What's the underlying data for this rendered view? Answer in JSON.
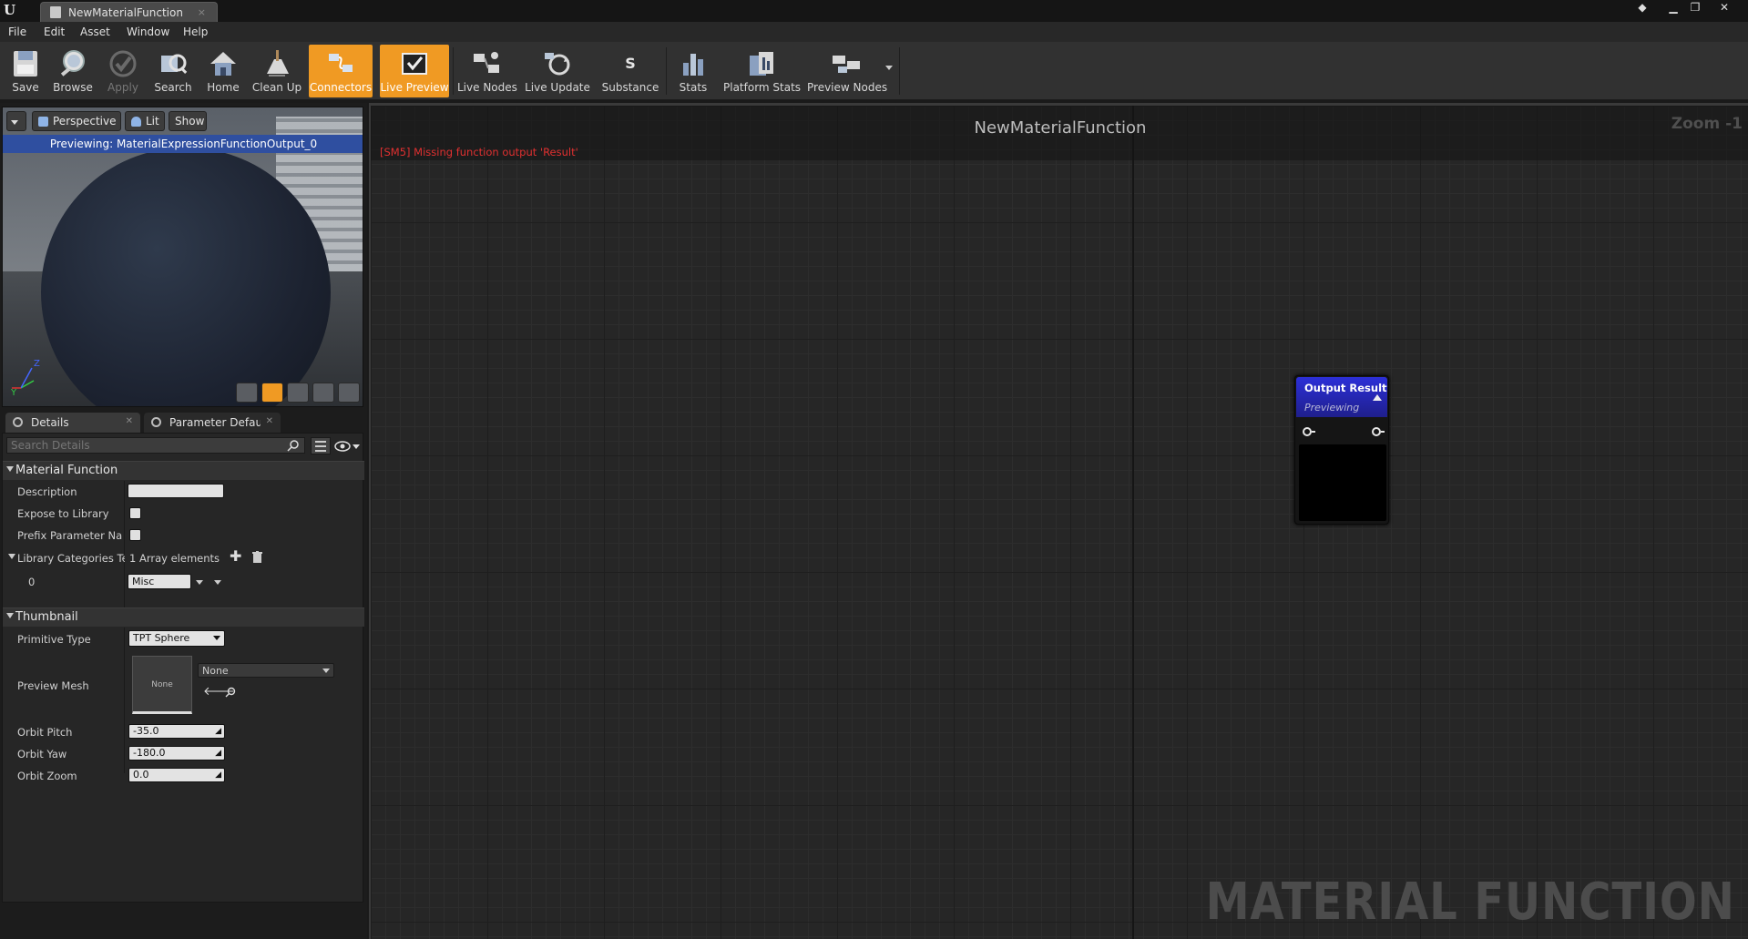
{
  "window": {
    "tab_title": "NewMaterialFunction",
    "tab_close": "×"
  },
  "menu": {
    "items": [
      "File",
      "Edit",
      "Asset",
      "Window",
      "Help"
    ]
  },
  "toolbar": {
    "buttons": [
      {
        "label": "Save",
        "icon": "save-icon"
      },
      {
        "label": "Browse",
        "icon": "browse-icon"
      },
      {
        "label": "Apply",
        "icon": "apply-icon",
        "state": "disabled"
      },
      {
        "label": "Search",
        "icon": "search-icon"
      },
      {
        "label": "Home",
        "icon": "home-icon"
      },
      {
        "label": "Clean Up",
        "icon": "clean-up-icon"
      },
      {
        "label": "Connectors",
        "icon": "connectors-icon",
        "state": "active"
      },
      {
        "label": "Live Preview",
        "icon": "live-preview-icon",
        "state": "active"
      },
      {
        "label": "Live Nodes",
        "icon": "live-nodes-icon"
      },
      {
        "label": "Live Update",
        "icon": "live-update-icon"
      },
      {
        "label": "Substance",
        "icon": "substance-icon"
      },
      {
        "label": "Stats",
        "icon": "stats-icon"
      },
      {
        "label": "Platform Stats",
        "icon": "platform-stats-icon"
      },
      {
        "label": "Preview Nodes",
        "icon": "preview-nodes-icon"
      }
    ],
    "accent_color": "#f09a23"
  },
  "viewport": {
    "perspective_label": "Perspective",
    "lit_label": "Lit",
    "show_label": "Show",
    "preview_banner": "Previewing: MaterialExpressionFunctionOutput_0",
    "axis_z": "Z",
    "axis_y": "Y"
  },
  "details_tabs": {
    "details": "Details",
    "parameter_defaults": "Parameter Defaults"
  },
  "details": {
    "search_placeholder": "Search Details",
    "material_function": {
      "header": "Material Function",
      "description_label": "Description",
      "description_value": "",
      "expose_label": "Expose to Library",
      "prefix_label": "Prefix Parameter Names",
      "library_label": "Library Categories Text",
      "array_count": "1 Array elements",
      "element_index": "0",
      "element_value": "Misc"
    },
    "thumbnail": {
      "header": "Thumbnail",
      "primitive_label": "Primitive Type",
      "primitive_value": "TPT Sphere",
      "preview_mesh_label": "Preview Mesh",
      "preview_mesh_thumb": "None",
      "preview_mesh_value": "None",
      "orbit_pitch_label": "Orbit Pitch",
      "orbit_pitch_value": "-35.0",
      "orbit_yaw_label": "Orbit Yaw",
      "orbit_yaw_value": "-180.0",
      "orbit_zoom_label": "Orbit Zoom",
      "orbit_zoom_value": "0.0"
    }
  },
  "graph": {
    "title": "NewMaterialFunction",
    "zoom": "Zoom -1",
    "error": "[SM5] Missing function output 'Result'",
    "watermark": "MATERIAL FUNCTION",
    "node": {
      "title": "Output Result",
      "subtitle": "Previewing",
      "header_color": "#2c2fd8"
    }
  }
}
